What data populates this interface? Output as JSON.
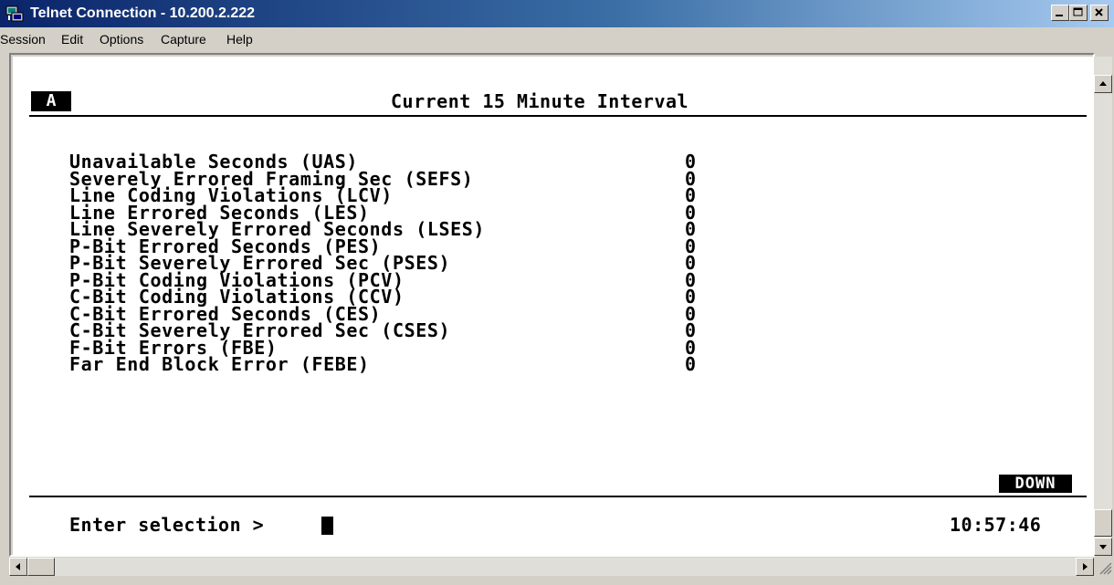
{
  "window": {
    "title": "Telnet Connection - 10.200.2.222",
    "icon": "telnet-app-icon"
  },
  "menu": {
    "items": [
      "Session",
      "Edit",
      "Options",
      "Capture",
      "Help"
    ]
  },
  "terminal": {
    "tab_label": "A",
    "screen_title": "Current 15 Minute Interval",
    "metrics": [
      {
        "label": "Unavailable Seconds (UAS)",
        "value": "0"
      },
      {
        "label": "Severely Errored Framing Sec (SEFS)",
        "value": "0"
      },
      {
        "label": "Line Coding Violations (LCV)",
        "value": "0"
      },
      {
        "label": "Line Errored Seconds (LES)",
        "value": "0"
      },
      {
        "label": "Line Severely Errored Seconds (LSES)",
        "value": "0"
      },
      {
        "label": "P-Bit Errored Seconds (PES)",
        "value": "0"
      },
      {
        "label": "P-Bit Severely Errored Sec (PSES)",
        "value": "0"
      },
      {
        "label": "P-Bit Coding Violations (PCV)",
        "value": "0"
      },
      {
        "label": "C-Bit Coding Violations (CCV)",
        "value": "0"
      },
      {
        "label": "C-Bit Errored Seconds (CES)",
        "value": "0"
      },
      {
        "label": "C-Bit Severely Errored Sec (CSES)",
        "value": "0"
      },
      {
        "label": "F-Bit Errors (FBE)",
        "value": "0"
      },
      {
        "label": "Far End Block Error (FEBE)",
        "value": "0"
      }
    ],
    "status_badge": "DOWN",
    "prompt": "Enter selection >",
    "clock": "10:57:46"
  }
}
